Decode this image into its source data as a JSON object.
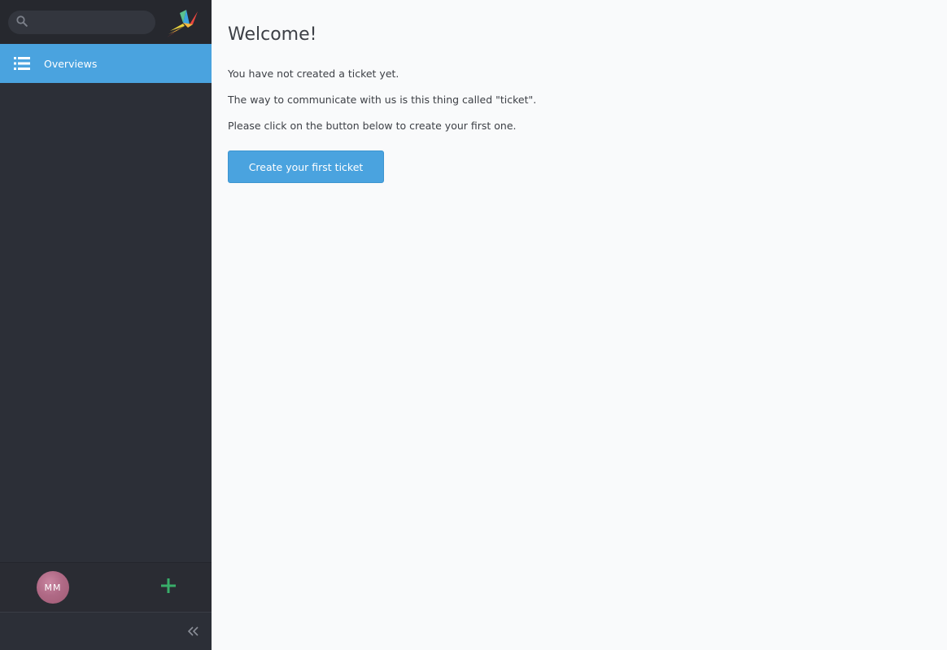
{
  "search": {
    "placeholder": ""
  },
  "sidebar": {
    "nav": [
      {
        "label": "Overviews",
        "icon": "list-icon",
        "active": true
      }
    ],
    "user": {
      "initials": "MM"
    }
  },
  "main": {
    "title": "Welcome!",
    "paragraphs": [
      "You have not created a ticket yet.",
      "The way to communicate with us is this thing called \"ticket\".",
      "Please click on the button below to create your first one."
    ],
    "cta_label": "Create your first ticket"
  },
  "colors": {
    "accent": "#4aa3df",
    "sidebar_bg": "#2c2f37",
    "add_green": "#38ad69"
  }
}
